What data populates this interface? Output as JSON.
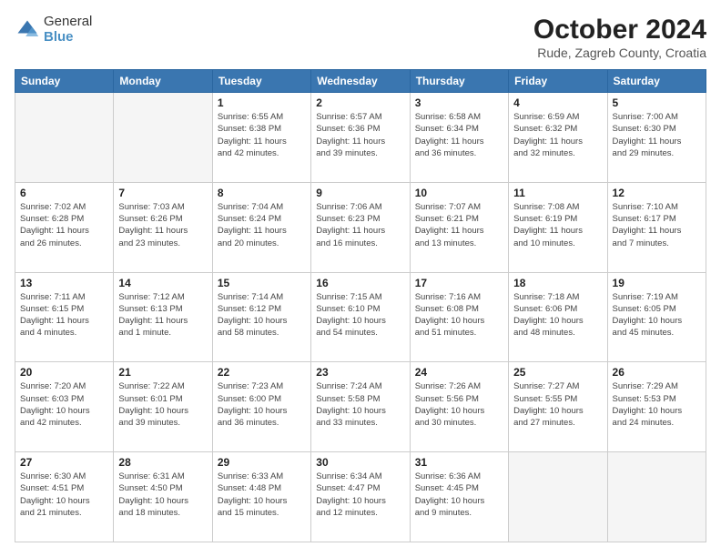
{
  "logo": {
    "general": "General",
    "blue": "Blue"
  },
  "header": {
    "month": "October 2024",
    "location": "Rude, Zagreb County, Croatia"
  },
  "weekdays": [
    "Sunday",
    "Monday",
    "Tuesday",
    "Wednesday",
    "Thursday",
    "Friday",
    "Saturday"
  ],
  "weeks": [
    [
      {
        "day": "",
        "info": ""
      },
      {
        "day": "",
        "info": ""
      },
      {
        "day": "1",
        "info": "Sunrise: 6:55 AM\nSunset: 6:38 PM\nDaylight: 11 hours\nand 42 minutes."
      },
      {
        "day": "2",
        "info": "Sunrise: 6:57 AM\nSunset: 6:36 PM\nDaylight: 11 hours\nand 39 minutes."
      },
      {
        "day": "3",
        "info": "Sunrise: 6:58 AM\nSunset: 6:34 PM\nDaylight: 11 hours\nand 36 minutes."
      },
      {
        "day": "4",
        "info": "Sunrise: 6:59 AM\nSunset: 6:32 PM\nDaylight: 11 hours\nand 32 minutes."
      },
      {
        "day": "5",
        "info": "Sunrise: 7:00 AM\nSunset: 6:30 PM\nDaylight: 11 hours\nand 29 minutes."
      }
    ],
    [
      {
        "day": "6",
        "info": "Sunrise: 7:02 AM\nSunset: 6:28 PM\nDaylight: 11 hours\nand 26 minutes."
      },
      {
        "day": "7",
        "info": "Sunrise: 7:03 AM\nSunset: 6:26 PM\nDaylight: 11 hours\nand 23 minutes."
      },
      {
        "day": "8",
        "info": "Sunrise: 7:04 AM\nSunset: 6:24 PM\nDaylight: 11 hours\nand 20 minutes."
      },
      {
        "day": "9",
        "info": "Sunrise: 7:06 AM\nSunset: 6:23 PM\nDaylight: 11 hours\nand 16 minutes."
      },
      {
        "day": "10",
        "info": "Sunrise: 7:07 AM\nSunset: 6:21 PM\nDaylight: 11 hours\nand 13 minutes."
      },
      {
        "day": "11",
        "info": "Sunrise: 7:08 AM\nSunset: 6:19 PM\nDaylight: 11 hours\nand 10 minutes."
      },
      {
        "day": "12",
        "info": "Sunrise: 7:10 AM\nSunset: 6:17 PM\nDaylight: 11 hours\nand 7 minutes."
      }
    ],
    [
      {
        "day": "13",
        "info": "Sunrise: 7:11 AM\nSunset: 6:15 PM\nDaylight: 11 hours\nand 4 minutes."
      },
      {
        "day": "14",
        "info": "Sunrise: 7:12 AM\nSunset: 6:13 PM\nDaylight: 11 hours\nand 1 minute."
      },
      {
        "day": "15",
        "info": "Sunrise: 7:14 AM\nSunset: 6:12 PM\nDaylight: 10 hours\nand 58 minutes."
      },
      {
        "day": "16",
        "info": "Sunrise: 7:15 AM\nSunset: 6:10 PM\nDaylight: 10 hours\nand 54 minutes."
      },
      {
        "day": "17",
        "info": "Sunrise: 7:16 AM\nSunset: 6:08 PM\nDaylight: 10 hours\nand 51 minutes."
      },
      {
        "day": "18",
        "info": "Sunrise: 7:18 AM\nSunset: 6:06 PM\nDaylight: 10 hours\nand 48 minutes."
      },
      {
        "day": "19",
        "info": "Sunrise: 7:19 AM\nSunset: 6:05 PM\nDaylight: 10 hours\nand 45 minutes."
      }
    ],
    [
      {
        "day": "20",
        "info": "Sunrise: 7:20 AM\nSunset: 6:03 PM\nDaylight: 10 hours\nand 42 minutes."
      },
      {
        "day": "21",
        "info": "Sunrise: 7:22 AM\nSunset: 6:01 PM\nDaylight: 10 hours\nand 39 minutes."
      },
      {
        "day": "22",
        "info": "Sunrise: 7:23 AM\nSunset: 6:00 PM\nDaylight: 10 hours\nand 36 minutes."
      },
      {
        "day": "23",
        "info": "Sunrise: 7:24 AM\nSunset: 5:58 PM\nDaylight: 10 hours\nand 33 minutes."
      },
      {
        "day": "24",
        "info": "Sunrise: 7:26 AM\nSunset: 5:56 PM\nDaylight: 10 hours\nand 30 minutes."
      },
      {
        "day": "25",
        "info": "Sunrise: 7:27 AM\nSunset: 5:55 PM\nDaylight: 10 hours\nand 27 minutes."
      },
      {
        "day": "26",
        "info": "Sunrise: 7:29 AM\nSunset: 5:53 PM\nDaylight: 10 hours\nand 24 minutes."
      }
    ],
    [
      {
        "day": "27",
        "info": "Sunrise: 6:30 AM\nSunset: 4:51 PM\nDaylight: 10 hours\nand 21 minutes."
      },
      {
        "day": "28",
        "info": "Sunrise: 6:31 AM\nSunset: 4:50 PM\nDaylight: 10 hours\nand 18 minutes."
      },
      {
        "day": "29",
        "info": "Sunrise: 6:33 AM\nSunset: 4:48 PM\nDaylight: 10 hours\nand 15 minutes."
      },
      {
        "day": "30",
        "info": "Sunrise: 6:34 AM\nSunset: 4:47 PM\nDaylight: 10 hours\nand 12 minutes."
      },
      {
        "day": "31",
        "info": "Sunrise: 6:36 AM\nSunset: 4:45 PM\nDaylight: 10 hours\nand 9 minutes."
      },
      {
        "day": "",
        "info": ""
      },
      {
        "day": "",
        "info": ""
      }
    ]
  ]
}
